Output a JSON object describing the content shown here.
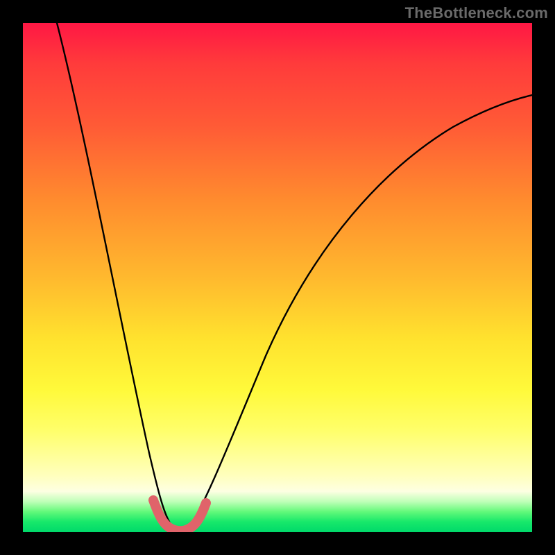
{
  "watermark": "TheBottleneck.com",
  "chart_data": {
    "type": "line",
    "title": "",
    "xlabel": "",
    "ylabel": "",
    "xlim": [
      0,
      100
    ],
    "ylim": [
      0,
      100
    ],
    "series": [
      {
        "name": "black-curve",
        "x": [
          6,
          10,
          14,
          18,
          22,
          24,
          26,
          27,
          28,
          29,
          30,
          32,
          34,
          38,
          44,
          52,
          60,
          70,
          80,
          90,
          100
        ],
        "values": [
          100,
          82,
          64,
          46,
          28,
          18,
          10,
          6,
          3,
          1,
          1,
          3,
          8,
          20,
          38,
          56,
          68,
          79,
          86,
          91,
          94
        ]
      },
      {
        "name": "pink-highlight",
        "x": [
          26,
          27,
          28,
          29,
          30,
          31,
          32,
          33
        ],
        "values": [
          7,
          3,
          1,
          1,
          1,
          2,
          4,
          8
        ]
      }
    ],
    "background_gradient": {
      "stops": [
        {
          "pos": 0.0,
          "color": "#ff1744"
        },
        {
          "pos": 0.2,
          "color": "#ff5a36"
        },
        {
          "pos": 0.5,
          "color": "#ffb92e"
        },
        {
          "pos": 0.72,
          "color": "#fff93a"
        },
        {
          "pos": 0.92,
          "color": "#fdffe2"
        },
        {
          "pos": 1.0,
          "color": "#00d96a"
        }
      ]
    }
  }
}
